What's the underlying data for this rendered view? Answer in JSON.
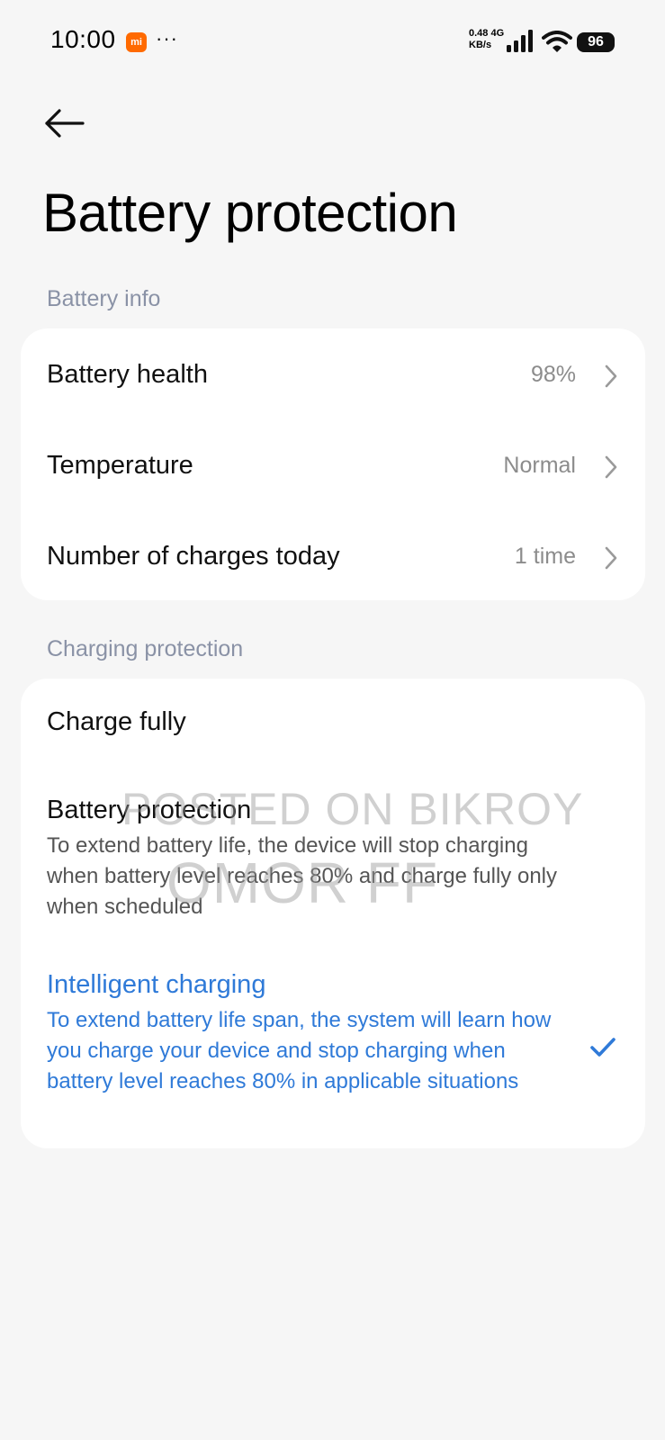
{
  "status_bar": {
    "time": "10:00",
    "mi_badge": "mi",
    "more_dots": "···",
    "net_speed_value": "0.48 4G",
    "net_speed_unit": "KB/s",
    "battery_level": "96"
  },
  "page": {
    "title": "Battery protection"
  },
  "battery_info": {
    "header": "Battery info",
    "rows": [
      {
        "label": "Battery health",
        "value": "98%"
      },
      {
        "label": "Temperature",
        "value": "Normal"
      },
      {
        "label": "Number of charges today",
        "value": "1 time"
      }
    ]
  },
  "charging_protection": {
    "header": "Charging protection",
    "options": [
      {
        "title": "Charge fully",
        "description": "",
        "selected": false
      },
      {
        "title": "Battery protection",
        "description": "To extend battery life, the device will stop charging when battery level reaches 80% and charge fully only when scheduled",
        "selected": false
      },
      {
        "title": "Intelligent charging",
        "description": "To extend battery life span, the system will learn how you charge your device and stop charging when battery level reaches 80% in applicable situations",
        "selected": true
      }
    ]
  },
  "watermark": {
    "line1": "POSTED ON BIKROY",
    "line2": "OMOR FF"
  },
  "colors": {
    "accent": "#2f7ad8",
    "background": "#f6f6f6",
    "section_header": "#8a92a6",
    "mi_orange": "#ff6a00"
  }
}
